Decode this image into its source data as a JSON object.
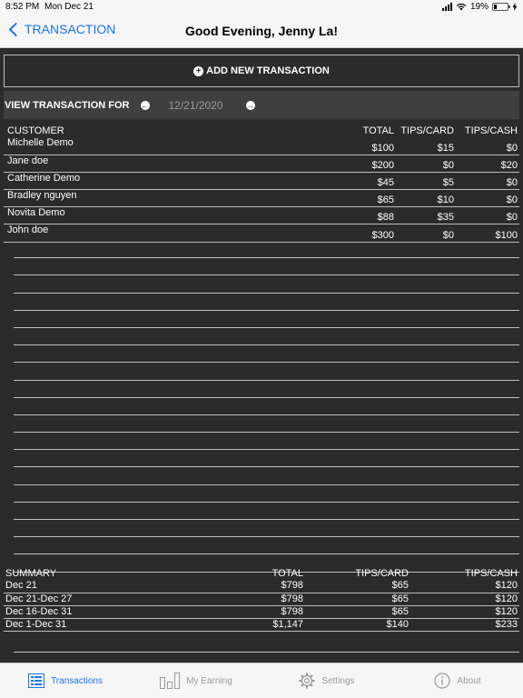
{
  "status_bar": {
    "time": "8:52 PM",
    "date": "Mon Dec 21",
    "battery": "19%"
  },
  "nav": {
    "back_label": "TRANSACTION",
    "title": "Good Evening, Jenny La!"
  },
  "add_button": {
    "label": "ADD NEW TRANSACTION"
  },
  "view_bar": {
    "label": "VIEW TRANSACTION FOR",
    "date": "12/21/2020"
  },
  "transactions": {
    "headers": [
      "CUSTOMER",
      "TOTAL",
      "TIPS/CARD",
      "TIPS/CASH"
    ],
    "rows": [
      [
        "Michelle Demo",
        "$100",
        "$15",
        "$0"
      ],
      [
        "Jane doe",
        "$200",
        "$0",
        "$20"
      ],
      [
        "Catherine Demo",
        "$45",
        "$5",
        "$0"
      ],
      [
        "Bradley nguyen",
        "$65",
        "$10",
        "$0"
      ],
      [
        "Novita Demo",
        "$88",
        "$35",
        "$0"
      ],
      [
        "John doe",
        "$300",
        "$0",
        "$100"
      ]
    ]
  },
  "summary": {
    "headers": [
      "SUMMARY",
      "TOTAL",
      "TIPS/CARD",
      "TIPS/CASH"
    ],
    "rows": [
      [
        "Dec 21",
        "$798",
        "$65",
        "$120"
      ],
      [
        "Dec 21-Dec 27",
        "$798",
        "$65",
        "$120"
      ],
      [
        "Dec 16-Dec 31",
        "$798",
        "$65",
        "$120"
      ],
      [
        "Dec 1-Dec 31",
        "$1,147",
        "$140",
        "$233"
      ]
    ]
  },
  "tabs": [
    {
      "label": "Transactions",
      "icon": "list-icon",
      "active": true
    },
    {
      "label": "My Earning",
      "icon": "bar-chart-icon",
      "active": false
    },
    {
      "label": "Settings",
      "icon": "gear-icon",
      "active": false
    },
    {
      "label": "About",
      "icon": "info-icon",
      "active": false
    }
  ],
  "colors": {
    "accent": "#1a73e8",
    "background": "#2b2b2b",
    "bar": "#3f3f3f"
  }
}
